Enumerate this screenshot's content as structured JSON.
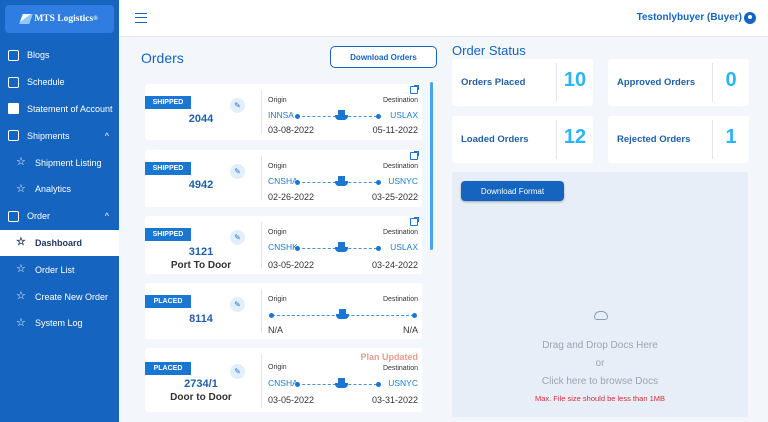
{
  "brand": {
    "name": "MTS Logistics",
    "mark": "®"
  },
  "sidebar": {
    "items": [
      {
        "label": "Blogs"
      },
      {
        "label": "Schedule"
      },
      {
        "label": "Statement of Account"
      },
      {
        "label": "Shipments",
        "chevron": "^"
      },
      {
        "label": "Shipment Listing"
      },
      {
        "label": "Analytics"
      },
      {
        "label": "Order",
        "chevron": "^"
      },
      {
        "label": "Dashboard"
      },
      {
        "label": "Order List"
      },
      {
        "label": "Create New Order"
      },
      {
        "label": "System Log"
      }
    ]
  },
  "topbar": {
    "user": "Testonlybuyer (Buyer)"
  },
  "orders": {
    "title": "Orders",
    "download_label": "Download Orders",
    "labels": {
      "origin": "Origin",
      "destination": "Destination"
    },
    "cards": [
      {
        "status": "SHIPPED",
        "number": "2044",
        "sub": "",
        "origin": "INNSA",
        "destination": "USLAX",
        "origin_date": "03-08-2022",
        "dest_date": "05-11-2022",
        "note": ""
      },
      {
        "status": "SHIPPED",
        "number": "4942",
        "sub": "",
        "origin": "CNSHA",
        "destination": "USNYC",
        "origin_date": "02-26-2022",
        "dest_date": "03-25-2022",
        "note": ""
      },
      {
        "status": "SHIPPED",
        "number": "3121",
        "sub": "Port To Door",
        "origin": "CNSHK",
        "destination": "USLAX",
        "origin_date": "03-05-2022",
        "dest_date": "03-24-2022",
        "note": ""
      },
      {
        "status": "PLACED",
        "number": "8114",
        "sub": "",
        "origin": "",
        "destination": "",
        "origin_date": "N/A",
        "dest_date": "N/A",
        "note": ""
      },
      {
        "status": "PLACED",
        "number": "2734/1",
        "sub": "Door to Door",
        "origin": "CNSHA",
        "destination": "USNYC",
        "origin_date": "03-05-2022",
        "dest_date": "03-31-2022",
        "note": "Plan Updated"
      }
    ]
  },
  "status": {
    "title": "Order Status",
    "stats": [
      {
        "label": "Orders Placed",
        "value": "10"
      },
      {
        "label": "Approved Orders",
        "value": "0"
      },
      {
        "label": "Loaded Orders",
        "value": "12"
      },
      {
        "label": "Rejected Orders",
        "value": "1"
      }
    ]
  },
  "upload": {
    "download_format": "Download Format",
    "drag_text": "Drag and Drop Docs Here",
    "or_text": "or",
    "browse_text": "Click here to browse Docs",
    "size_warning": "Max. File size should be less than 1MB"
  },
  "colors": {
    "primary": "#1565c0",
    "accent": "#29b6f6",
    "plan_updated": "#ef9a8f"
  }
}
